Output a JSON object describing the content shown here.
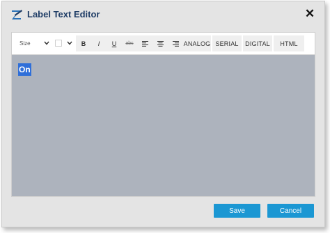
{
  "dialog": {
    "title": "Label Text Editor",
    "close_label": "✕"
  },
  "toolbar": {
    "size_label": "Size",
    "bold_label": "B",
    "italic_label": "I",
    "underline_label": "U",
    "strike_label": "abc",
    "analog_label": "ANALOG",
    "serial_label": "SERIAL",
    "digital_label": "DIGITAL",
    "html_label": "HTML"
  },
  "editor": {
    "content": "On",
    "background_color": "#adb3bd",
    "selection_color": "#2f6fd9"
  },
  "footer": {
    "save_label": "Save",
    "cancel_label": "Cancel"
  },
  "colors": {
    "title": "#1f3d66",
    "button": "#1b97d3"
  }
}
